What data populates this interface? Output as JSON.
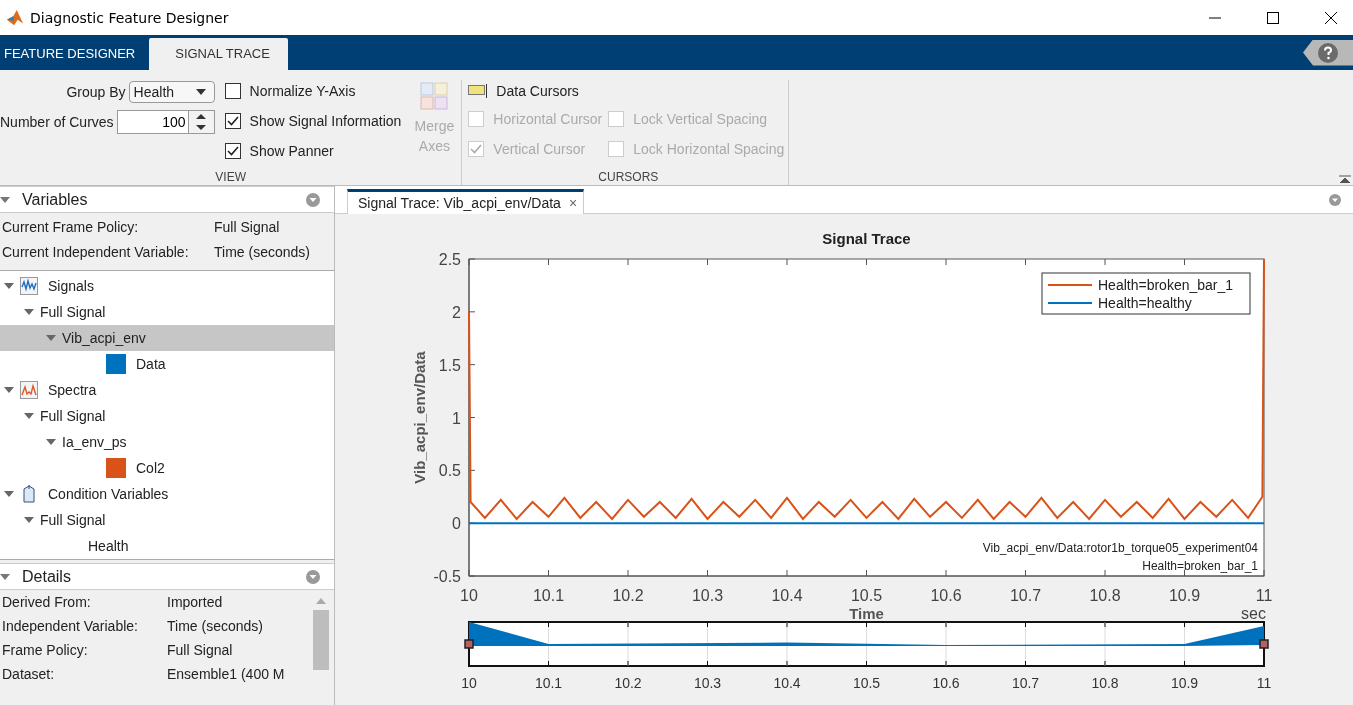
{
  "window": {
    "title": "Diagnostic Feature Designer"
  },
  "ribbon_tabs": [
    {
      "label": "FEATURE DESIGNER",
      "selected": false
    },
    {
      "label": "SIGNAL TRACE",
      "selected": true
    }
  ],
  "view_section": {
    "label": "VIEW",
    "group_by": {
      "label": "Group By",
      "value": "Health"
    },
    "number_of_curves": {
      "label": "Number of Curves",
      "value": "100"
    },
    "checkboxes": [
      {
        "label": "Normalize Y-Axis",
        "checked": false
      },
      {
        "label": "Show Signal Information",
        "checked": true
      },
      {
        "label": "Show Panner",
        "checked": true
      }
    ],
    "merge_axes": {
      "label": "Merge Axes",
      "disabled": true
    }
  },
  "cursors_section": {
    "label": "CURSORS",
    "data_cursors": "Data Cursors",
    "checkboxes": [
      {
        "label": "Horizontal Cursor",
        "checked": false,
        "disabled": true
      },
      {
        "label": "Lock Vertical Spacing",
        "checked": false,
        "disabled": true
      },
      {
        "label": "Vertical Cursor",
        "checked": true,
        "disabled": true
      },
      {
        "label": "Lock Horizontal Spacing",
        "checked": false,
        "disabled": true
      }
    ]
  },
  "variables_panel": {
    "title": "Variables",
    "info": [
      {
        "label": "Current Frame Policy:",
        "value": "Full Signal"
      },
      {
        "label": "Current Independent Variable:",
        "value": "Time (seconds)"
      }
    ],
    "tree": [
      {
        "label": "Signals",
        "kind": "signal",
        "expanded": true,
        "selected": false,
        "children": [
          {
            "label": "Full Signal",
            "expanded": true,
            "selected": false,
            "children": [
              {
                "label": "Vib_acpi_env",
                "expanded": true,
                "selected": true,
                "children": [
                  {
                    "label": "Data",
                    "color": "#0072bd",
                    "selected": false
                  }
                ]
              }
            ]
          }
        ]
      },
      {
        "label": "Spectra",
        "kind": "spectrum",
        "expanded": true,
        "selected": false,
        "children": [
          {
            "label": "Full Signal",
            "expanded": true,
            "selected": false,
            "children": [
              {
                "label": "Ia_env_ps",
                "expanded": true,
                "selected": false,
                "children": [
                  {
                    "label": "Col2",
                    "color": "#d95319",
                    "selected": false
                  }
                ]
              }
            ]
          }
        ]
      },
      {
        "label": "Condition Variables",
        "kind": "condition",
        "expanded": true,
        "selected": false,
        "children": [
          {
            "label": "Full Signal",
            "expanded": true,
            "selected": false,
            "children": [
              {
                "label": "Health",
                "selected": false
              }
            ]
          }
        ]
      }
    ]
  },
  "details_panel": {
    "title": "Details",
    "rows": [
      {
        "label": "Derived From:",
        "value": "Imported"
      },
      {
        "label": "Independent Variable:",
        "value": "Time (seconds)"
      },
      {
        "label": "Frame Policy:",
        "value": "Full Signal"
      },
      {
        "label": "Dataset:",
        "value": "Ensemble1 (400 M"
      }
    ]
  },
  "document_tab": {
    "label": "Signal Trace: Vib_acpi_env/Data",
    "close": "×"
  },
  "plot": {
    "chart_data": {
      "type": "line",
      "title": "Signal Trace",
      "xlabel": "Time",
      "ylabel": "Vib_acpi_env/Data",
      "xlim": [
        10,
        11
      ],
      "ylim": [
        -0.5,
        2.5
      ],
      "legend": true,
      "x": [
        10,
        10.002,
        10.02,
        10.04,
        10.06,
        10.08,
        10.1,
        10.12,
        10.14,
        10.16,
        10.18,
        10.2,
        10.22,
        10.24,
        10.26,
        10.28,
        10.3,
        10.32,
        10.34,
        10.36,
        10.38,
        10.4,
        10.42,
        10.44,
        10.46,
        10.48,
        10.5,
        10.52,
        10.54,
        10.56,
        10.58,
        10.6,
        10.62,
        10.64,
        10.66,
        10.68,
        10.7,
        10.72,
        10.74,
        10.76,
        10.78,
        10.8,
        10.82,
        10.84,
        10.86,
        10.88,
        10.9,
        10.92,
        10.94,
        10.96,
        10.98,
        10.998,
        11
      ],
      "xticks": [
        10,
        10.1,
        10.2,
        10.3,
        10.4,
        10.5,
        10.6,
        10.7,
        10.8,
        10.9,
        11
      ],
      "yticks": [
        -0.5,
        0,
        0.5,
        1,
        1.5,
        2,
        2.5
      ],
      "series": [
        {
          "name": "Health=broken_bar_1",
          "color": "#d95319",
          "values": [
            2.0,
            0.2,
            0.05,
            0.22,
            0.04,
            0.2,
            0.06,
            0.24,
            0.05,
            0.2,
            0.04,
            0.22,
            0.06,
            0.2,
            0.05,
            0.23,
            0.04,
            0.2,
            0.06,
            0.22,
            0.05,
            0.24,
            0.04,
            0.2,
            0.06,
            0.22,
            0.05,
            0.2,
            0.04,
            0.23,
            0.06,
            0.2,
            0.05,
            0.22,
            0.04,
            0.2,
            0.06,
            0.24,
            0.05,
            0.2,
            0.04,
            0.22,
            0.06,
            0.2,
            0.05,
            0.23,
            0.04,
            0.2,
            0.06,
            0.22,
            0.05,
            0.25,
            2.5
          ]
        },
        {
          "name": "Health=healthy",
          "color": "#0072bd",
          "values": [
            0.0,
            0.0,
            0.0,
            0.0,
            0.0,
            0.0,
            0.0,
            0.0,
            0.0,
            0.0,
            0.0,
            0.0,
            0.0,
            0.0,
            0.0,
            0.0,
            0.0,
            0.0,
            0.0,
            0.0,
            0.0,
            0.0,
            0.0,
            0.0,
            0.0,
            0.0,
            0.0,
            0.0,
            0.0,
            0.0,
            0.0,
            0.0,
            0.0,
            0.0,
            0.0,
            0.0,
            0.0,
            0.0,
            0.0,
            0.0,
            0.0,
            0.0,
            0.0,
            0.0,
            0.0,
            0.0,
            0.0,
            0.0,
            0.0,
            0.0,
            0.0,
            0.0,
            0.0
          ]
        }
      ],
      "annotations": [
        "Vib_acpi_env/Data:rotor1b_torque05_experiment04",
        "Health=broken_bar_1"
      ]
    },
    "unit": "sec",
    "panner": {
      "xticks": [
        "10",
        "10.1",
        "10.2",
        "10.3",
        "10.4",
        "10.5",
        "10.6",
        "10.7",
        "10.8",
        "10.9",
        "11"
      ]
    }
  }
}
